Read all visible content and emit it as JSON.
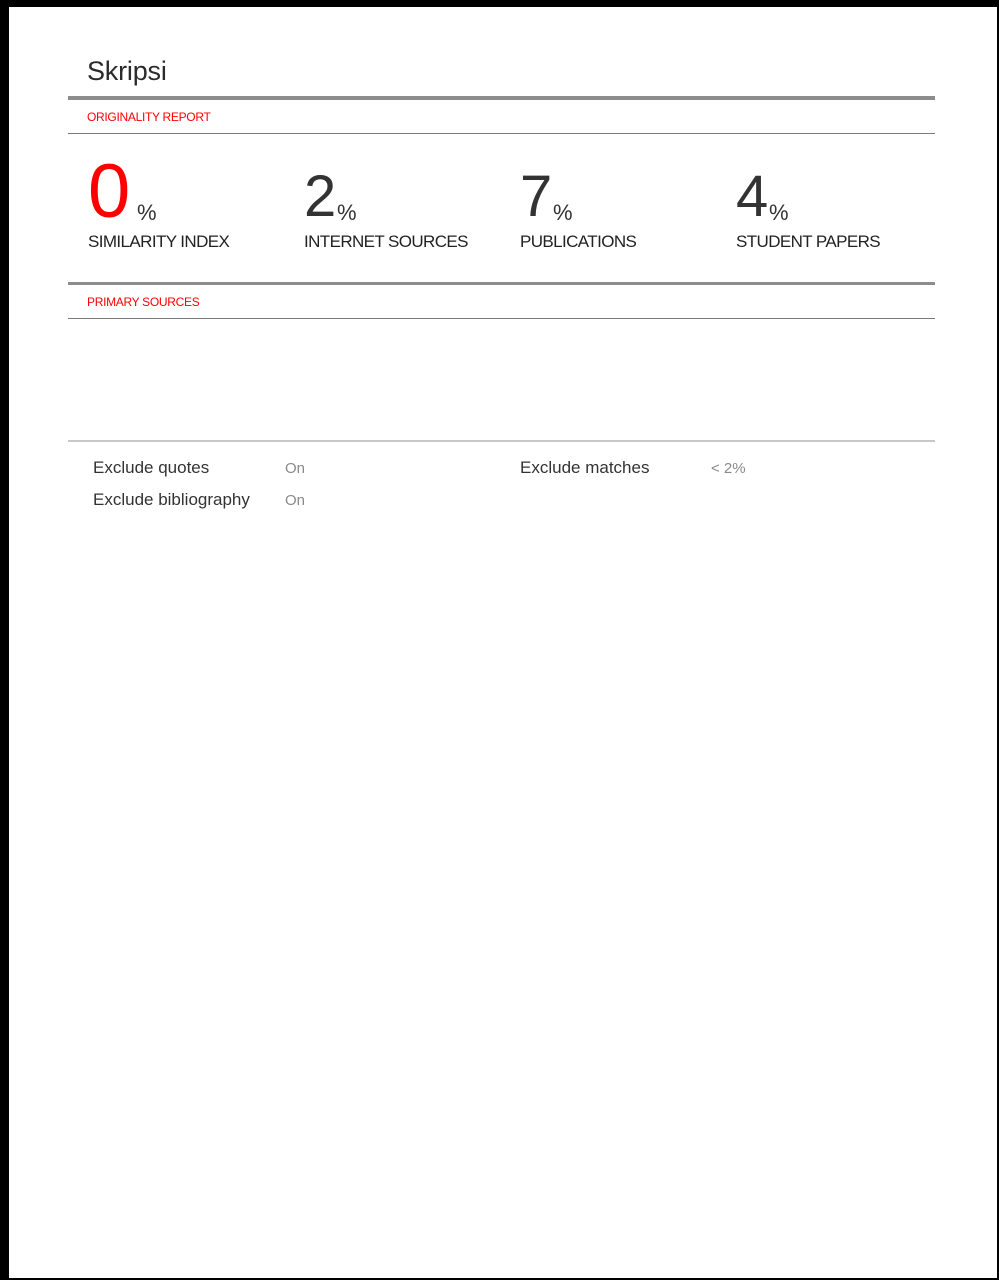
{
  "document": {
    "title": "Skripsi"
  },
  "report": {
    "header": "ORIGINALITY REPORT",
    "stats": [
      {
        "value": "0",
        "unit": "%",
        "label": "SIMILARITY INDEX",
        "color": "#ff0000"
      },
      {
        "value": "2",
        "unit": "%",
        "label": "INTERNET SOURCES",
        "color": "#333333"
      },
      {
        "value": "7",
        "unit": "%",
        "label": "PUBLICATIONS",
        "color": "#333333"
      },
      {
        "value": "4",
        "unit": "%",
        "label": "STUDENT PAPERS",
        "color": "#333333"
      }
    ],
    "primary_sources_header": "PRIMARY SOURCES"
  },
  "exclusions": {
    "quotes_label": "Exclude quotes",
    "quotes_value": "On",
    "bibliography_label": "Exclude bibliography",
    "bibliography_value": "On",
    "matches_label": "Exclude matches",
    "matches_value": "< 2%"
  },
  "colors": {
    "accent": "#ff0000",
    "rule": "#8c8c8c"
  }
}
